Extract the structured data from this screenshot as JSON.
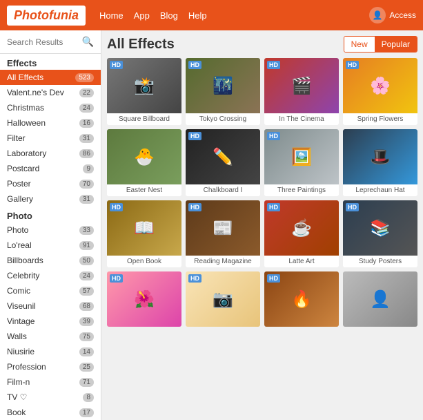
{
  "header": {
    "logo": "Photofunia",
    "nav": [
      "Home",
      "App",
      "Blog",
      "Help"
    ],
    "access_label": "Access"
  },
  "sidebar": {
    "search_placeholder": "Search Results",
    "sections": [
      {
        "title": "Effects",
        "items": [
          {
            "label": "All Effects",
            "count": "523",
            "active": true
          },
          {
            "label": "Valent.ne's Dev",
            "count": "22"
          },
          {
            "label": "Christmas",
            "count": "24"
          },
          {
            "label": "Halloween",
            "count": "16"
          },
          {
            "label": "Filter",
            "count": "31"
          },
          {
            "label": "Laboratory",
            "count": "86"
          },
          {
            "label": "Postcard",
            "count": "9"
          },
          {
            "label": "Poster",
            "count": "70"
          },
          {
            "label": "Gallery",
            "count": "31"
          }
        ]
      },
      {
        "title": "Photo",
        "items": [
          {
            "label": "Photo",
            "count": "33"
          },
          {
            "label": "Lo'real",
            "count": "91"
          },
          {
            "label": "Billboards",
            "count": "50"
          },
          {
            "label": "Celebrity",
            "count": "24"
          },
          {
            "label": "Comic",
            "count": "57"
          },
          {
            "label": "Viseunil",
            "count": "68"
          },
          {
            "label": "Vintage",
            "count": "39"
          },
          {
            "label": "Walls",
            "count": "75"
          },
          {
            "label": "Niusirie",
            "count": "14"
          },
          {
            "label": "Profession",
            "count": "25"
          },
          {
            "label": "Film-n",
            "count": "71"
          },
          {
            "label": "TV ♡",
            "count": "8"
          },
          {
            "label": "Book",
            "count": "17"
          }
        ]
      }
    ]
  },
  "content": {
    "title": "All Effects",
    "tabs": [
      {
        "label": "New",
        "active": false
      },
      {
        "label": "Popular",
        "active": true
      }
    ],
    "effects": [
      {
        "name": "Square Billboard",
        "hd": true,
        "color": "c1"
      },
      {
        "name": "Tokyo Crossing",
        "hd": true,
        "color": "c2"
      },
      {
        "name": "In The Cinema",
        "hd": true,
        "color": "c3"
      },
      {
        "name": "Spring Flowers",
        "hd": true,
        "color": "c4"
      },
      {
        "name": "Easter Nest",
        "hd": false,
        "color": "c5"
      },
      {
        "name": "Chalkboard I",
        "hd": true,
        "color": "c6"
      },
      {
        "name": "Three Paintings",
        "hd": true,
        "color": "c7"
      },
      {
        "name": "Leprechaun Hat",
        "hd": false,
        "color": "c8"
      },
      {
        "name": "Open Book",
        "hd": true,
        "color": "c9"
      },
      {
        "name": "Reading Magazine",
        "hd": true,
        "color": "c10"
      },
      {
        "name": "Latte Art",
        "hd": true,
        "color": "c11"
      },
      {
        "name": "Study Posters",
        "hd": true,
        "color": "c12"
      },
      {
        "name": "",
        "hd": true,
        "color": "c13"
      },
      {
        "name": "",
        "hd": true,
        "color": "c14"
      },
      {
        "name": "",
        "hd": true,
        "color": "c15"
      },
      {
        "name": "",
        "hd": false,
        "color": "c16"
      }
    ]
  }
}
